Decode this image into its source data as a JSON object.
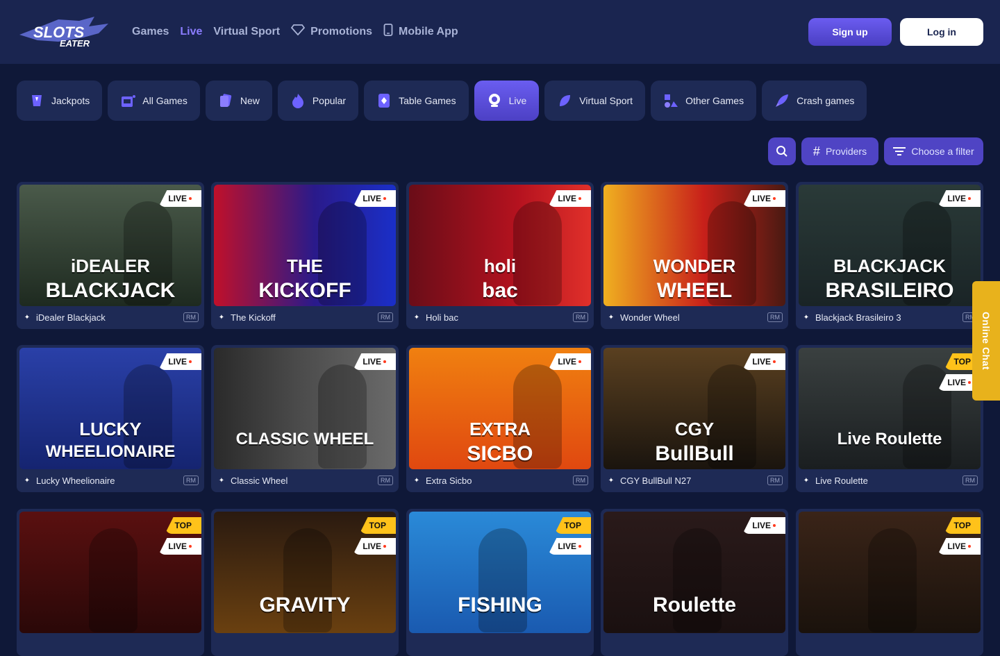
{
  "brand": {
    "line1": "SLOTS",
    "line2": "EATER"
  },
  "nav": [
    {
      "label": "Games",
      "active": false,
      "icon": ""
    },
    {
      "label": "Live",
      "active": true,
      "icon": ""
    },
    {
      "label": "Virtual Sport",
      "active": false,
      "icon": ""
    },
    {
      "label": "Promotions",
      "active": false,
      "icon": "diamond-icon"
    },
    {
      "label": "Mobile App",
      "active": false,
      "icon": "phone-icon"
    }
  ],
  "auth": {
    "signup": "Sign up",
    "login": "Log in"
  },
  "categories": [
    {
      "label": "Jackpots",
      "icon": "jackpot-icon",
      "active": false
    },
    {
      "label": "All Games",
      "icon": "slot-machine-icon",
      "active": false
    },
    {
      "label": "New",
      "icon": "cards-icon",
      "active": false
    },
    {
      "label": "Popular",
      "icon": "flame-icon",
      "active": false
    },
    {
      "label": "Table Games",
      "icon": "card-diamond-icon",
      "active": false
    },
    {
      "label": "Live",
      "icon": "webcam-icon",
      "active": true
    },
    {
      "label": "Virtual Sport",
      "icon": "leaf-icon",
      "active": false
    },
    {
      "label": "Other Games",
      "icon": "shapes-icon",
      "active": false
    },
    {
      "label": "Crash games",
      "icon": "rocket-icon",
      "active": false
    }
  ],
  "tools": {
    "providers": "Providers",
    "filter": "Choose a filter"
  },
  "games": [
    {
      "name": "iDealer Blackjack",
      "art1": "iDEALER",
      "art2": "BLACKJACK",
      "badges": [
        "LIVE"
      ],
      "bg": "linear-gradient(180deg,#4a5a4a,#1e2a20)"
    },
    {
      "name": "The Kickoff",
      "art1": "THE",
      "art2": "KICKOFF",
      "badges": [
        "LIVE"
      ],
      "bg": "linear-gradient(90deg,#c0102a,#2a1a8a 55%,#1a2fc8)"
    },
    {
      "name": "Holi bac",
      "art1": "holi",
      "art2": "bac",
      "badges": [
        "LIVE"
      ],
      "bg": "linear-gradient(90deg,#6a0d18,#b5121f 60%,#e0302a)"
    },
    {
      "name": "Wonder Wheel",
      "art1": "WONDER",
      "art2": "WHEEL",
      "badges": [
        "LIVE"
      ],
      "bg": "linear-gradient(90deg,#f0b020,#c8201a 55%,#4a1a12)"
    },
    {
      "name": "Blackjack Brasileiro 3",
      "art1": "BLACKJACK",
      "art2": "BRASILEIRO",
      "badges": [
        "LIVE"
      ],
      "bg": "linear-gradient(180deg,#2a3a38,#1a2426)"
    },
    {
      "name": "Lucky Wheelionaire",
      "art1": "LUCKY",
      "art2": "WHEELIONAIRE",
      "badges": [
        "LIVE"
      ],
      "bg": "linear-gradient(180deg,#2a40a8,#152470)"
    },
    {
      "name": "Classic Wheel",
      "art1": "",
      "art2": "CLASSIC WHEEL",
      "badges": [
        "LIVE"
      ],
      "bg": "linear-gradient(90deg,#2a2a2a,#4a4a4a 45%,#6a6a6a)"
    },
    {
      "name": "Extra Sicbo",
      "art1": "EXTRA",
      "art2": "SICBO",
      "badges": [
        "LIVE"
      ],
      "bg": "linear-gradient(180deg,#f08010,#e04810)"
    },
    {
      "name": "CGY BullBull N27",
      "art1": "CGY",
      "art2": "BullBull",
      "badges": [
        "LIVE"
      ],
      "bg": "linear-gradient(180deg,#5a4020,#1a140e)"
    },
    {
      "name": "Live Roulette",
      "art1": "",
      "art2": "Live Roulette",
      "badges": [
        "TOP",
        "LIVE"
      ],
      "bg": "linear-gradient(180deg,#3a4040,#1a1e20)"
    },
    {
      "name": "",
      "art1": "",
      "art2": "",
      "badges": [
        "TOP",
        "LIVE"
      ],
      "bg": "linear-gradient(180deg,#5a1010,#2a0808)"
    },
    {
      "name": "",
      "art1": "",
      "art2": "GRAVITY",
      "badges": [
        "TOP",
        "LIVE"
      ],
      "bg": "linear-gradient(180deg,#2a1a10,#6a4010)"
    },
    {
      "name": "",
      "art1": "",
      "art2": "FISHING",
      "badges": [
        "TOP",
        "LIVE"
      ],
      "bg": "linear-gradient(180deg,#2a8ad8,#1a5ab0)"
    },
    {
      "name": "",
      "art1": "",
      "art2": "Roulette",
      "badges": [
        "LIVE"
      ],
      "bg": "linear-gradient(180deg,#2a1a1a,#1a1010)"
    },
    {
      "name": "",
      "art1": "",
      "art2": "",
      "badges": [
        "TOP",
        "LIVE"
      ],
      "bg": "linear-gradient(180deg,#3a2418,#1a120c)"
    }
  ],
  "provider_tag": "RM",
  "chat": "Online Chat"
}
